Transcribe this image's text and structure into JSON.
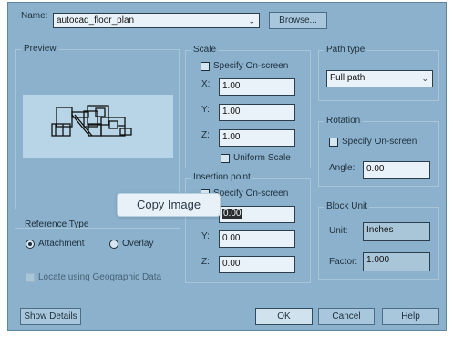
{
  "dialog": {
    "name_label": "Name:",
    "name_value": "autocad_floor_plan",
    "browse_label": "Browse..."
  },
  "preview": {
    "title": "Preview"
  },
  "reference_type": {
    "title": "Reference Type",
    "attachment_label": "Attachment",
    "overlay_label": "Overlay",
    "selected": "Attachment"
  },
  "geo": {
    "label": "Locate using Geographic Data",
    "checked": false,
    "enabled": false
  },
  "scale": {
    "title": "Scale",
    "specify_label": "Specify On-screen",
    "x_label": "X:",
    "x_value": "1.00",
    "y_label": "Y:",
    "y_value": "1.00",
    "z_label": "Z:",
    "z_value": "1.00",
    "uniform_label": "Uniform Scale"
  },
  "insertion": {
    "title": "Insertion point",
    "specify_label": "Specify On-screen",
    "x_value": "0.00",
    "y_label": "Y:",
    "y_value": "0.00",
    "z_label": "Z:",
    "z_value": "0.00"
  },
  "path_type": {
    "title": "Path type",
    "value": "Full path"
  },
  "rotation": {
    "title": "Rotation",
    "specify_label": "Specify On-screen",
    "angle_label": "Angle:",
    "angle_value": "0.00"
  },
  "block_unit": {
    "title": "Block Unit",
    "unit_label": "Unit:",
    "unit_value": "Inches",
    "factor_label": "Factor:",
    "factor_value": "1.000"
  },
  "buttons": {
    "show_details": "Show Details",
    "ok": "OK",
    "cancel": "Cancel",
    "help": "Help"
  },
  "tooltip": {
    "text": "Copy Image"
  },
  "colors": {
    "dialog_bg": "#8bb1cc",
    "field_bg": "#e9f2f8",
    "preview_bg": "#b7d5e7"
  }
}
